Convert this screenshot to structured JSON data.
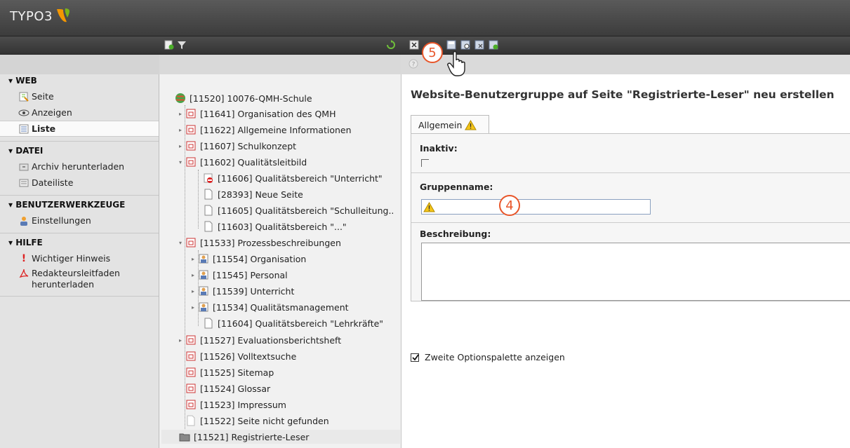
{
  "header": {
    "logo_text": "TYPO3",
    "logo_color": "#f49700"
  },
  "module_menu": {
    "groups": [
      {
        "title": "▾ WEB",
        "items": [
          "Seite",
          "Anzeigen",
          "Liste"
        ]
      },
      {
        "title": "▾ DATEI",
        "items": [
          "Archiv herunterladen",
          "Dateiliste"
        ]
      },
      {
        "title": "▾ BENUTZERWERKZEUGE",
        "items": [
          "Einstellungen"
        ]
      },
      {
        "title": "▾ HILFE",
        "items": [
          "Wichtiger Hinweis",
          "Redakteursleitfaden herunterladen"
        ]
      }
    ]
  },
  "tree": {
    "nodes": [
      "[11520] 10076-QMH-Schule",
      "[11641] Organisation des QMH",
      "[11622] Allgemeine Informationen",
      "[11607] Schulkonzept",
      "[11602] Qualitätsleitbild",
      "[11606] Qualitätsbereich \"Unterricht\"",
      "[28393] Neue Seite",
      "[11605] Qualitätsbereich \"Schulleitung..",
      "[11603] Qualitätsbereich \"...\"",
      "[11533] Prozessbeschreibungen",
      "[11554] Organisation",
      "[11545] Personal",
      "[11539] Unterricht",
      "[11534] Qualitätsmanagement",
      "[11604] Qualitätsbereich \"Lehrkräfte\"",
      "[11527] Evaluationsberichtsheft",
      "[11526] Volltextsuche",
      "[11525] Sitemap",
      "[11524] Glossar",
      "[11523] Impressum",
      "[11522] Seite nicht gefunden",
      "[11521] Registrierte-Leser"
    ]
  },
  "main": {
    "title": "Website-Benutzergruppe auf Seite \"Registrierte-Leser\" neu erstellen",
    "tab_label": "Allgemein",
    "fields": {
      "inaktiv_label": "Inaktiv:",
      "gruppenname_label": "Gruppenname:",
      "gruppenname_value": "",
      "beschreibung_label": "Beschreibung:",
      "beschreibung_value": ""
    },
    "option_label": "Zweite Optionspalette anzeigen",
    "option_checked": true
  },
  "callouts": [
    "5",
    "4"
  ]
}
